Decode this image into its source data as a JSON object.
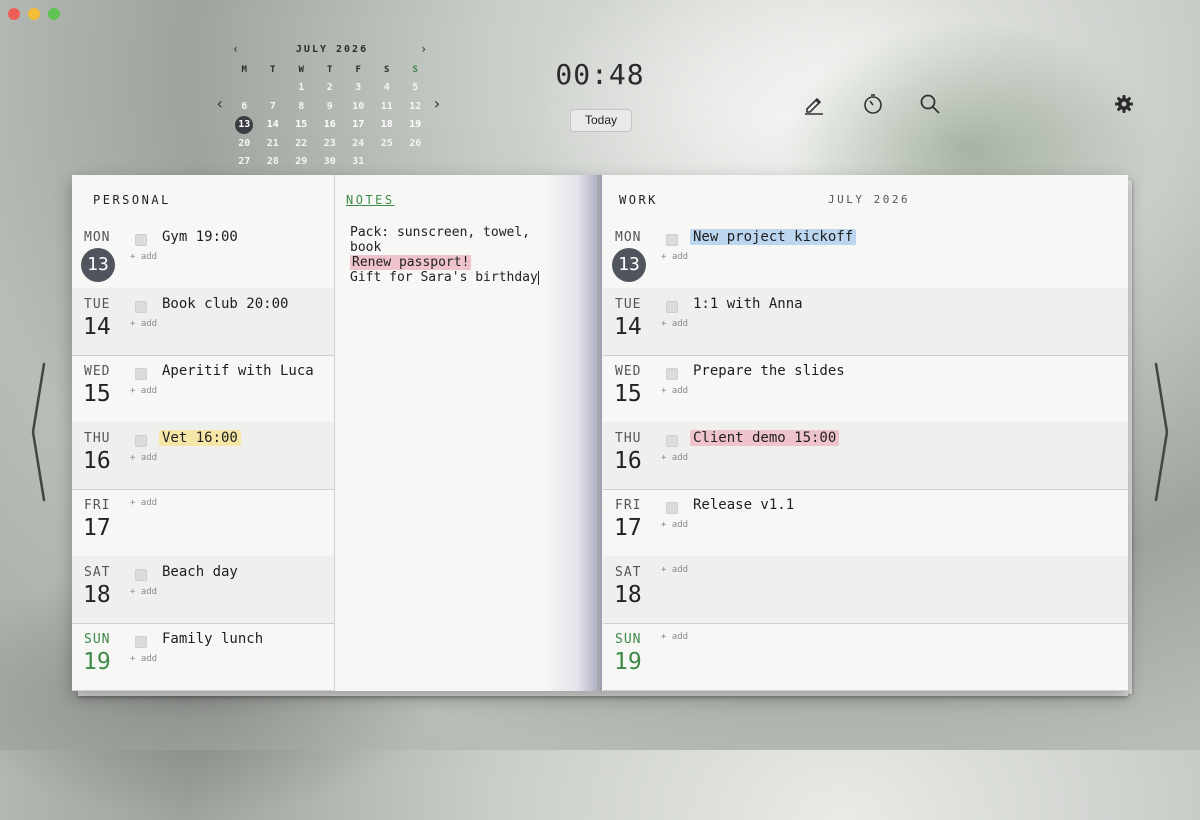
{
  "window": {
    "traffic_lights": {
      "close": "#ec5f57",
      "minimize": "#f4bd39",
      "zoom": "#5fc454"
    }
  },
  "mini_calendar": {
    "month_label": "JULY 2026",
    "weekdays": [
      "M",
      "T",
      "W",
      "T",
      "F",
      "S",
      "S"
    ],
    "weeks": [
      [
        "",
        "",
        "1",
        "2",
        "3",
        "4",
        "5"
      ],
      [
        "6",
        "7",
        "8",
        "9",
        "10",
        "11",
        "12"
      ],
      [
        "13",
        "14",
        "15",
        "16",
        "17",
        "18",
        "19"
      ],
      [
        "20",
        "21",
        "22",
        "23",
        "24",
        "25",
        "26"
      ],
      [
        "27",
        "28",
        "29",
        "30",
        "31",
        "",
        ""
      ]
    ],
    "selected_day": "13",
    "current_week_index": 2
  },
  "clock": {
    "time": "00:48"
  },
  "toolbar": {
    "today_label": "Today",
    "icons": [
      "pencil-icon",
      "timer-icon",
      "search-icon",
      "gear-icon"
    ]
  },
  "personal": {
    "header": "PERSONAL",
    "add_label": "+ add",
    "days": [
      {
        "name": "MON",
        "num": "13",
        "today": true,
        "task": "Gym 19:00",
        "highlight": ""
      },
      {
        "name": "TUE",
        "num": "14",
        "task": "Book club 20:00",
        "highlight": ""
      },
      {
        "name": "WED",
        "num": "15",
        "task": "Aperitif with Luca",
        "highlight": ""
      },
      {
        "name": "THU",
        "num": "16",
        "task": "Vet 16:00",
        "highlight": "yellow"
      },
      {
        "name": "FRI",
        "num": "17",
        "task": "",
        "highlight": ""
      },
      {
        "name": "SAT",
        "num": "18",
        "task": "Beach day",
        "highlight": ""
      },
      {
        "name": "SUN",
        "num": "19",
        "task": "Family lunch",
        "highlight": ""
      }
    ]
  },
  "notes": {
    "header": "NOTES",
    "lines": [
      "Pack: sunscreen, towel, book",
      "Renew passport!",
      "Gift for Sara's birthday"
    ]
  },
  "work": {
    "header": "WORK",
    "month_label": "JULY 2026",
    "days": [
      {
        "name": "MON",
        "num": "13",
        "today": true,
        "task": "New project kickoff",
        "highlight": "blue"
      },
      {
        "name": "TUE",
        "num": "14",
        "task": "1:1 with Anna",
        "highlight": ""
      },
      {
        "name": "WED",
        "num": "15",
        "task": "Prepare the slides",
        "highlight": ""
      },
      {
        "name": "THU",
        "num": "16",
        "task": "Client demo 15:00",
        "highlight": "pink"
      },
      {
        "name": "FRI",
        "num": "17",
        "task": "Release v1.1",
        "highlight": ""
      },
      {
        "name": "SAT",
        "num": "18",
        "task": "",
        "highlight": ""
      },
      {
        "name": "SUN",
        "num": "19",
        "task": "",
        "highlight": ""
      }
    ]
  },
  "colors": {
    "accent_green": "#3e8a48",
    "today_circle": "#50545c"
  }
}
